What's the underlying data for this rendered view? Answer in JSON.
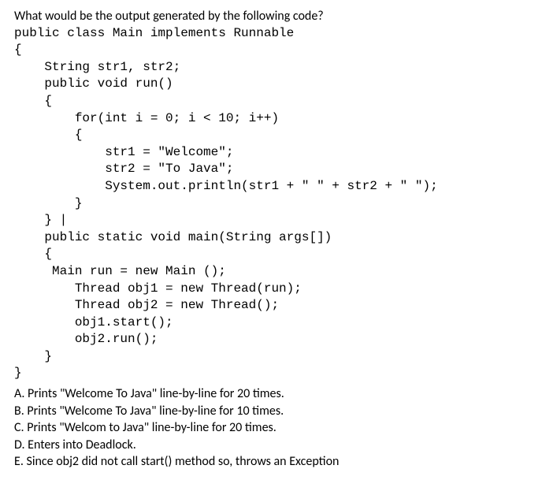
{
  "question": "What would be the output generated by the following code?",
  "code": "public class Main implements Runnable\n{\n    String str1, str2;\n    public void run()\n    {\n        for(int i = 0; i < 10; i++)\n        {\n            str1 = \"Welcome\";\n            str2 = \"To Java\";\n            System.out.println(str1 + \" \" + str2 + \" \");\n        }\n    } |\n    public static void main(String args[])\n    {\n     Main run = new Main ();\n        Thread obj1 = new Thread(run);\n        Thread obj2 = new Thread();\n        obj1.start();\n        obj2.run();\n    }\n}",
  "options": {
    "a": "A. Prints \"Welcome To Java\" line-by-line for 20 times.",
    "b": "B. Prints \"Welcome To Java\" line-by-line for 10 times.",
    "c": "C. Prints \"Welcom to Java\" line-by-line for 20 times.",
    "d": "D. Enters into Deadlock.",
    "e": "E. Since obj2 did not call start() method so, throws an Exception"
  }
}
